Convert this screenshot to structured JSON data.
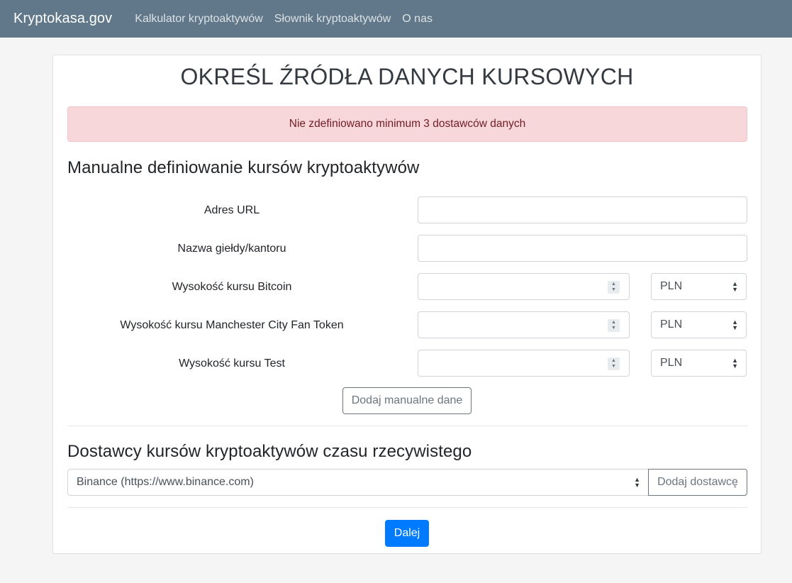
{
  "navbar": {
    "brand": "Kryptokasa.gov",
    "links": [
      "Kalkulator kryptoaktywów",
      "Słownik kryptoaktywów",
      "O nas"
    ]
  },
  "page": {
    "title": "OKREŚL ŹRÓDŁA DANYCH KURSOWYCH",
    "alert": "Nie zdefiniowano minimum 3 dostawców danych"
  },
  "manual": {
    "heading": "Manualne definiowanie kursów kryptoaktywów",
    "url_label": "Adres URL",
    "url_value": "",
    "exchange_label": "Nazwa giełdy/kantoru",
    "exchange_value": "",
    "rates": [
      {
        "label": "Wysokość kursu Bitcoin",
        "value": "",
        "currency": "PLN"
      },
      {
        "label": "Wysokość kursu Manchester City Fan Token",
        "value": "",
        "currency": "PLN"
      },
      {
        "label": "Wysokość kursu Test",
        "value": "",
        "currency": "PLN"
      }
    ],
    "add_button": "Dodaj manualne dane"
  },
  "realtime": {
    "heading": "Dostawcy kursów kryptoaktywów czasu rzecywistego",
    "selected_provider": "Binance (https://www.binance.com)",
    "add_button": "Dodaj dostawcę"
  },
  "next_button": "Dalej",
  "colors": {
    "navbar": "#607889",
    "alert_bg": "#f8d7da",
    "alert_text": "#721c24",
    "primary": "#007bff"
  }
}
